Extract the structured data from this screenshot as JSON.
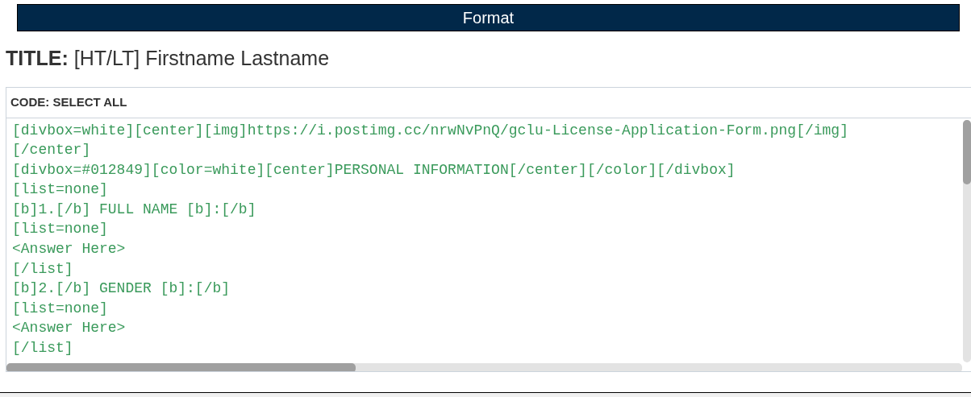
{
  "header": {
    "title": "Format"
  },
  "post_title": {
    "label": "TITLE:",
    "value": "[HT/LT] Firstname Lastname"
  },
  "code_box": {
    "heading": "CODE: SELECT ALL",
    "lines": [
      "[divbox=white][center][img]https://i.postimg.cc/nrwNvPnQ/gclu-License-Application-Form.png[/img]",
      "[/center]",
      "[divbox=#012849][color=white][center]PERSONAL INFORMATION[/center][/color][/divbox]",
      "[list=none]",
      "[b]1.[/b] FULL NAME [b]:[/b]",
      "[list=none]",
      "<Answer Here>",
      "[/list]",
      "[b]2.[/b] GENDER [b]:[/b]",
      "[list=none]",
      "<Answer Here>",
      "[/list]"
    ]
  }
}
